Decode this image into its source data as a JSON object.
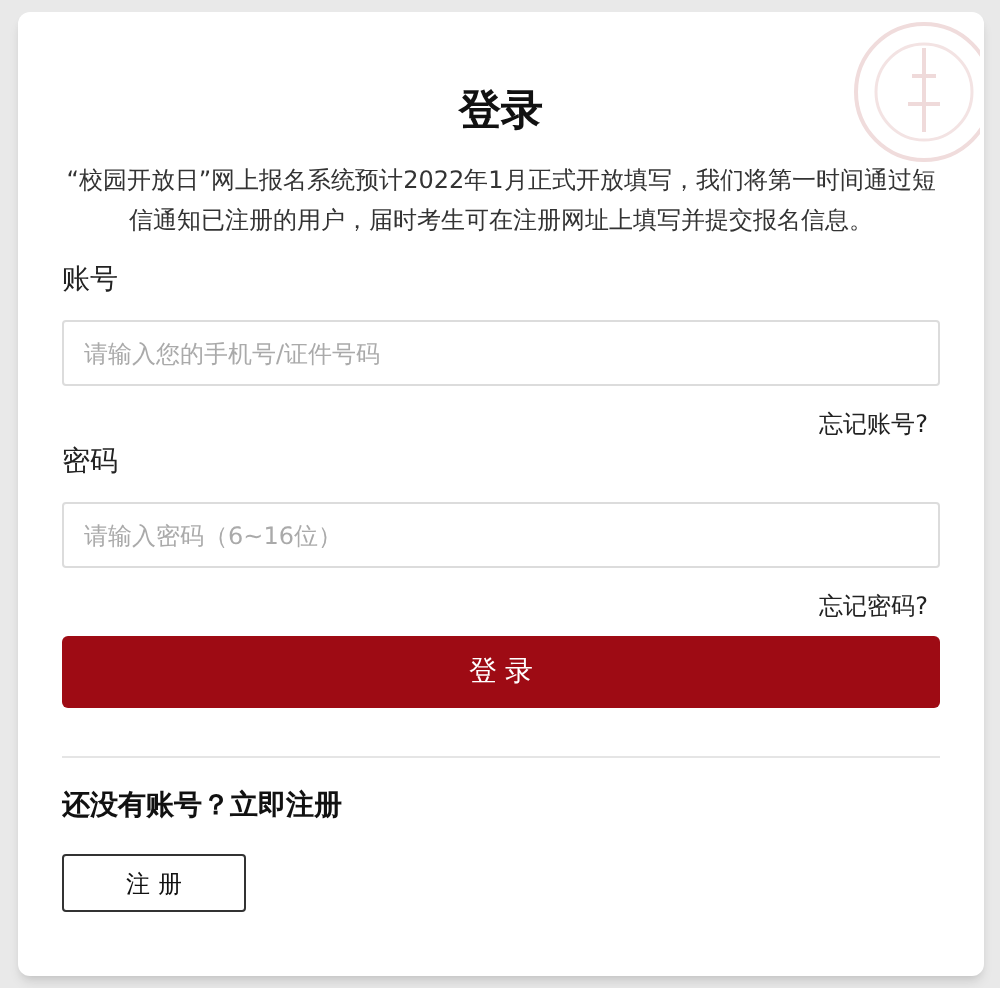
{
  "title": "登录",
  "notice": "“校园开放日”网上报名系统预计2022年1月正式开放填写，我们将第一时间通过短信通知已注册的用户，届时考生可在注册网址上填写并提交报名信息。",
  "fields": [
    {
      "label": "账号",
      "placeholder": "请输入您的手机号/证件号码",
      "forgot": "忘记账号?"
    },
    {
      "label": "密码",
      "placeholder": "请输入密码（6~16位）",
      "forgot": "忘记密码?"
    }
  ],
  "login_button": "登 录",
  "register_prompt": "还没有账号？立即注册",
  "register_button": "注 册"
}
